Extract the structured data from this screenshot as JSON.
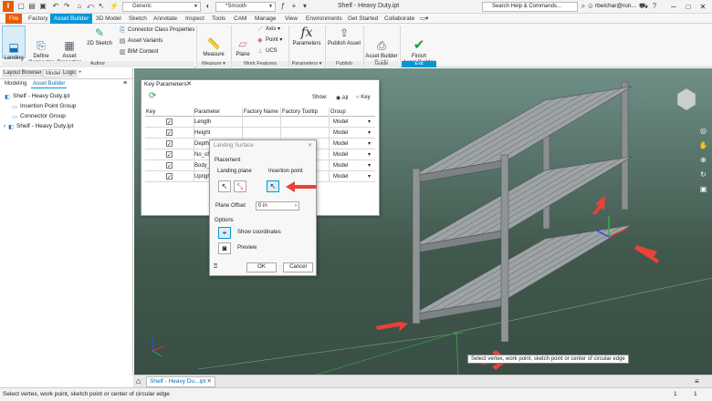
{
  "window": {
    "title": "Shelf - Heavy Duty.ipt",
    "appearance_combo": "Generic",
    "visual_style_combo": "*Smooth",
    "search_placeholder": "Search Help & Commands...",
    "user": "rbelchar@run...",
    "minimize": "─",
    "maximize": "□",
    "close": "✕"
  },
  "menu": {
    "tabs": [
      "File",
      "Factory",
      "Asset Builder",
      "3D Model",
      "Sketch",
      "Annotate",
      "Inspect",
      "Tools",
      "CAM",
      "Manage",
      "View",
      "Environments",
      "Get Started",
      "Collaborate"
    ],
    "active": "Asset Builder"
  },
  "ribbon": {
    "author": {
      "landing_surface": "Landing\nSurface",
      "define_connector": "Define\nConnector",
      "asset_properties": "Asset\nProperties",
      "sketch_2d": "2D Sketch",
      "connector_class_properties": "Connector Class Properties",
      "asset_variants": "Asset Variants",
      "bim_content": "BIM Content",
      "panel": "Author"
    },
    "measure": {
      "measure": "Measure",
      "panel": "Measure ▾"
    },
    "work_features": {
      "plane": "Plane",
      "axis": "Axis ▾",
      "point": "Point ▾",
      "ucs": "UCS",
      "panel": "Work Features"
    },
    "parameters": {
      "parameters": "Parameters",
      "panel": "Parameters ▾"
    },
    "publish": {
      "publish_asset": "Publish Asset",
      "panel": "Publish"
    },
    "guide": {
      "asset_builder_guide": "Asset Builder\nGuide",
      "panel": "Guide"
    },
    "exit": {
      "finish": "Finish\nAsset Builder",
      "panel": "Exit"
    }
  },
  "browser": {
    "tabs": [
      "Layout Browser",
      "Model",
      "Logic"
    ],
    "plus": "+",
    "subtabs": [
      "Modeling",
      "Asset Builder"
    ],
    "tree": [
      "Shelf - Heavy Duty.ipt",
      "Insertion Point Group",
      "Connector Group",
      "Shelf - Heavy Duty.ipt"
    ]
  },
  "key_params": {
    "title": "Key Parameters",
    "close": "✕",
    "show_label": "Show:",
    "show_all": "All",
    "show_key": "Key",
    "headers": [
      "Key",
      "Parameter",
      "Factory Name",
      "Factory Tooltip",
      "Group"
    ],
    "rows": [
      {
        "key": "✓",
        "param": "Length",
        "group": "Model"
      },
      {
        "key": "✓",
        "param": "Height",
        "group": "Model"
      },
      {
        "key": "✓",
        "param": "Depth",
        "group": "Model"
      },
      {
        "key": "✓",
        "param": "No_of_...",
        "group": "Model"
      },
      {
        "key": "✓",
        "param": "Body_...",
        "group": "Model"
      },
      {
        "key": "✓",
        "param": "Upright...",
        "group": "Model"
      }
    ]
  },
  "landing_surface": {
    "title": "Landing Surface",
    "close": "✕",
    "placement": "Placement",
    "landing_plane": "Landing plane",
    "insertion_point": "Insertion point",
    "plane_offset_label": "Plane Offset",
    "plane_offset_value": "0 in",
    "options": "Options",
    "show_coordinates": "Show coordinates",
    "preview": "Preview",
    "ok": "OK",
    "cancel": "Cancel"
  },
  "viewport": {
    "tooltip": "Select vertex, work point, sketch point or center of circular edge"
  },
  "doc_tabs": {
    "home_icon": "⌂",
    "tab_label": "Shelf - Heavy Du...ipt",
    "tab_close": "✕"
  },
  "status": {
    "text": "Select vertex, work point, sketch point or center of circular edge",
    "counter1": "1",
    "counter2": "1"
  },
  "colors": {
    "accent": "#0696d7",
    "file_tab": "#e65c00",
    "arrow": "#e8423a",
    "viewport_top": "#6f8f87",
    "viewport_bottom": "#394e44"
  }
}
